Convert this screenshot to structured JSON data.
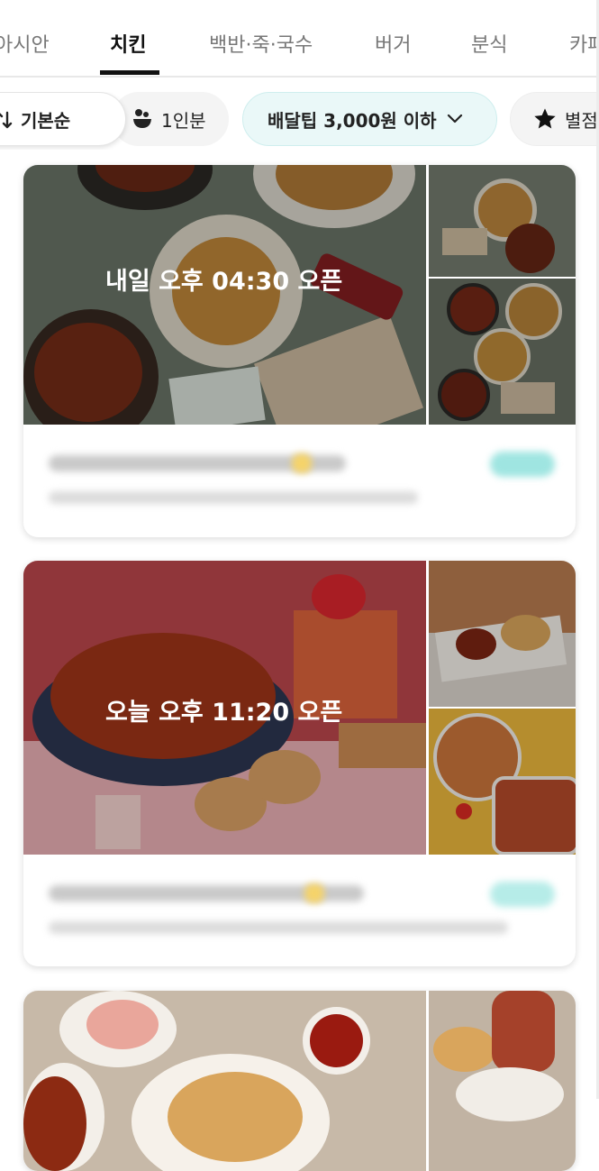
{
  "tabs": [
    {
      "label": "아시안",
      "active": false
    },
    {
      "label": "치킨",
      "active": true
    },
    {
      "label": "백반·죽·국수",
      "active": false
    },
    {
      "label": "버거",
      "active": false
    },
    {
      "label": "분식",
      "active": false
    },
    {
      "label": "카페",
      "active": false
    }
  ],
  "filters": {
    "sort_label": "기본순",
    "single_label": "1인분",
    "tip_label": "배달팁 3,000원 이하",
    "rating_label": "별점"
  },
  "stores": [
    {
      "open_label": "내일 오후 04:30 오픈"
    },
    {
      "open_label": "오늘 오후 11:20 오픈"
    },
    {
      "open_label": ""
    }
  ],
  "colors": {
    "accent_chip_bg": "#eaf8f8",
    "active_tab": "#111111",
    "badge_mint": "#7fe0dc",
    "star_yellow": "#f5c518"
  }
}
